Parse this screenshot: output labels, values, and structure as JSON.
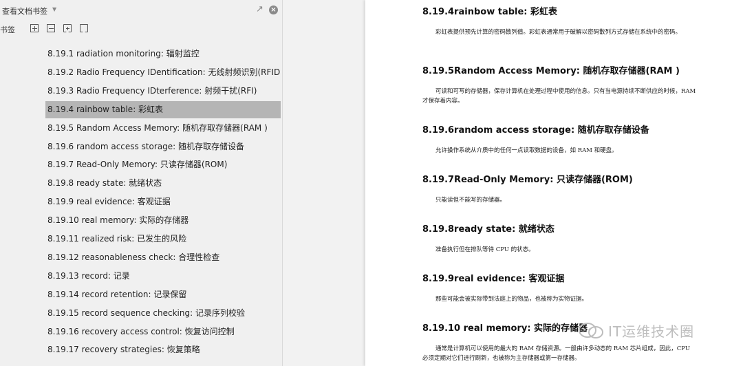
{
  "sidebar": {
    "title": "查看文档书签",
    "label": "书签",
    "bookmarks": [
      "8.19.1 radiation monitoring: 辐射监控",
      "8.19.2 Radio Frequency IDentification: 无线射频识别(RFID)",
      "8.19.3 Radio Frequency IDterference: 射频干扰(RFI)",
      "8.19.4 rainbow table: 彩虹表",
      "8.19.5 Random Access Memory: 随机存取存储器(RAM )",
      "8.19.6 random access storage: 随机存取存储设备",
      "8.19.7 Read-Only Memory: 只读存储器(ROM)",
      "8.19.8 ready state: 就绪状态",
      "8.19.9 real evidence: 客观证据",
      "8.19.10 real memory: 实际的存储器",
      "8.19.11 realized risk: 已发生的风险",
      "8.19.12 reasonableness check: 合理性检查",
      "8.19.13 record: 记录",
      "8.19.14 record retention: 记录保留",
      "8.19.15 record sequence checking: 记录序列校验",
      "8.19.16 recovery access control: 恢复访问控制",
      "8.19.17 recovery strategies: 恢复策略"
    ],
    "selected_index": 3
  },
  "document": {
    "sections": [
      {
        "heading": "8.19.4rainbow table:  彩虹表",
        "body": "彩虹表提供预先计算的密码散列值。彩虹表通常用于破解以密码散列方式存储在系统中的密码。"
      },
      {
        "heading": "8.19.5Random Access Memory:  随机存取存储器(RAM )",
        "body": "可读和可写的存储器，保存计算机在处理过程中使用的信息。只有当电源持续不断供应的时候，RAM  才保存着内容。"
      },
      {
        "heading": "8.19.6random access storage:  随机存取存储设备",
        "body": "允许操作系统从介质中的任何一点读取数据的设备，如  RAM  和硬盘。"
      },
      {
        "heading": "8.19.7Read-Only Memory:  只读存储器(ROM)",
        "body": "只能读但不能写的存储器。"
      },
      {
        "heading": "8.19.8ready state:  就绪状态",
        "body": "准备执行但在排队等待 CPU  的状态。"
      },
      {
        "heading": "8.19.9real evidence:  客观证据",
        "body": "那些可能会被实际带到法庭上的物品，也被称为实物证据。"
      },
      {
        "heading": "8.19.10    real memory:  实际的存储器",
        "body": "通常是计算机可以使用的最大的  RAM  存储资源。一般由许多动态的  RAM  芯片组成，因此，CPU  必须定期对它们进行刷新，也被称为主存储器或第一存储器。"
      }
    ]
  },
  "watermark": "IT运维技术圈"
}
